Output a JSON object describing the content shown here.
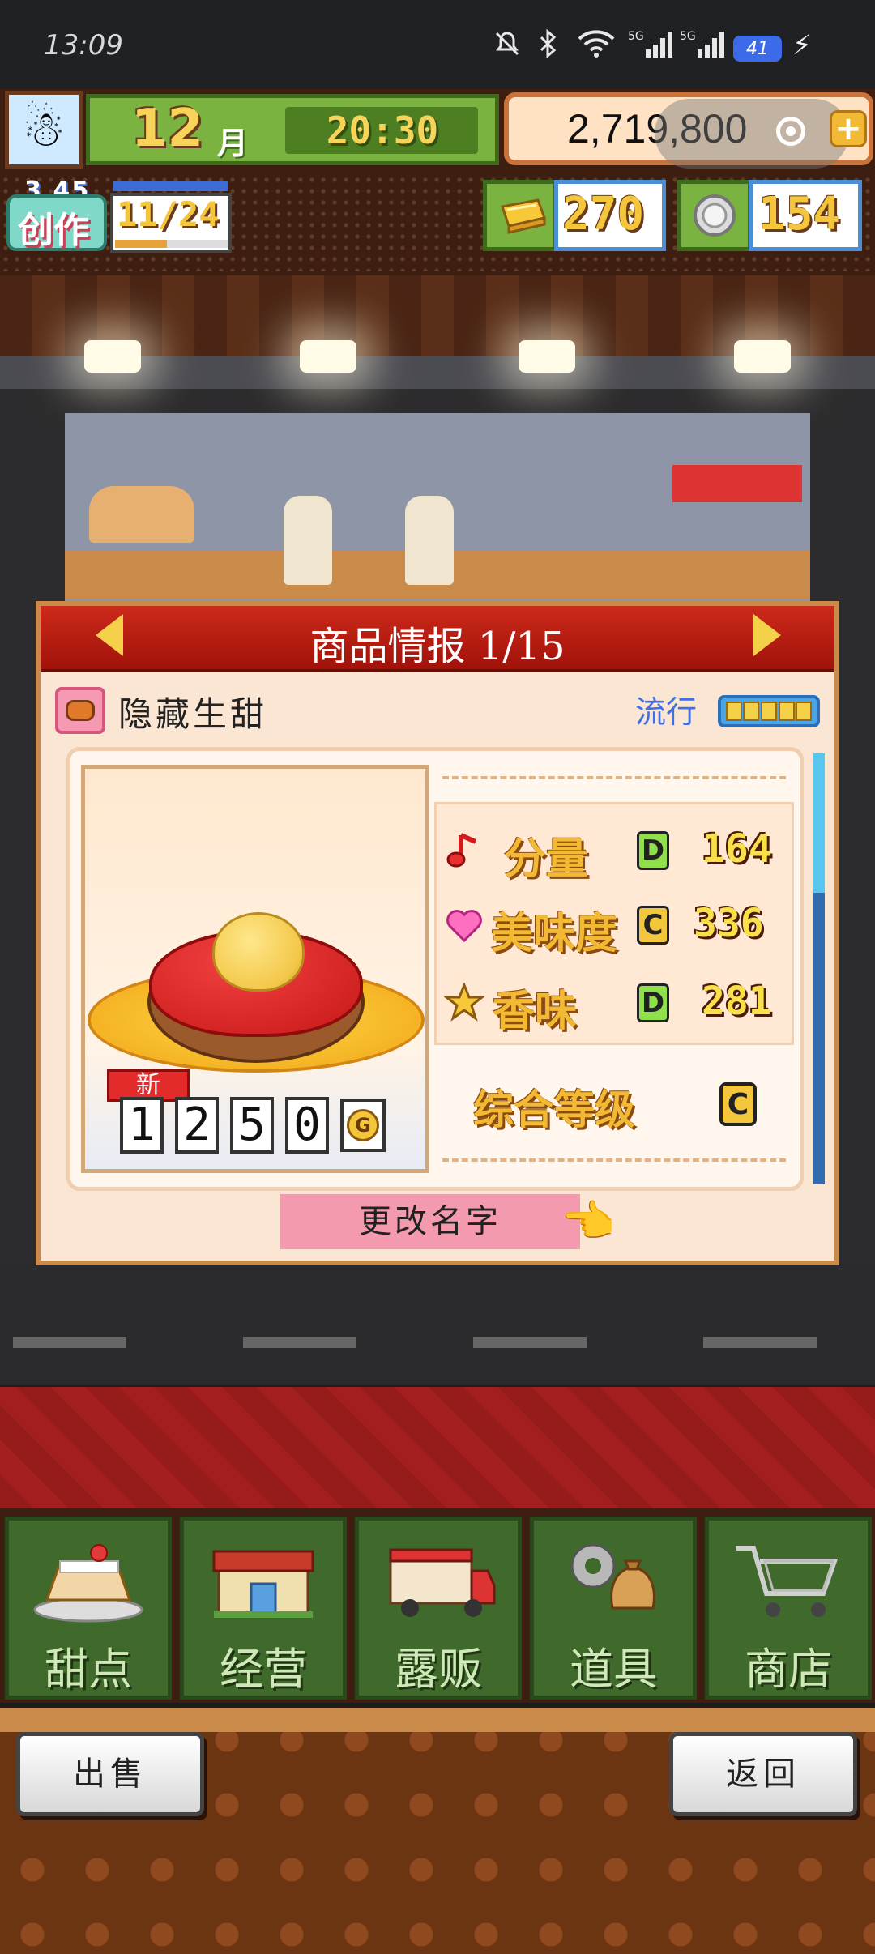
{
  "status_bar": {
    "time": "13:09",
    "battery": "41"
  },
  "hud": {
    "month_number": "12",
    "month_unit": "月",
    "clock": "20:30",
    "money": "2,719,800",
    "create_small": "3 45",
    "create_label": "创作",
    "create_count": "11/24",
    "create_progress": 0.46,
    "gold_bars": "270",
    "medals": "154"
  },
  "dialog": {
    "title": "商品情报 1/15",
    "product_name": "隐藏生甜",
    "trend_label": "流行",
    "trend_level": 5,
    "new_badge": "新",
    "price_digits": [
      "1",
      "2",
      "5",
      "0"
    ],
    "price_unit": "G",
    "stats": [
      {
        "label": "分量",
        "grade": "D",
        "value": "164",
        "icon": "music-note-icon"
      },
      {
        "label": "美味度",
        "grade": "C",
        "value": "336",
        "icon": "heart-icon"
      },
      {
        "label": "香味",
        "grade": "D",
        "value": "281",
        "icon": "star-icon"
      }
    ],
    "overall_label": "综合等级",
    "overall_grade": "C",
    "rename_label": "更改名字"
  },
  "menu": [
    {
      "label": "甜点",
      "icon": "cake-icon"
    },
    {
      "label": "经营",
      "icon": "shop-icon"
    },
    {
      "label": "露贩",
      "icon": "food-truck-icon"
    },
    {
      "label": "道具",
      "icon": "tools-bag-icon"
    },
    {
      "label": "商店",
      "icon": "shopping-cart-icon"
    }
  ],
  "bottom": {
    "sell_label": "出售",
    "back_label": "返回"
  },
  "colors": {
    "header_red": "#cc2a1a",
    "menu_green": "#3f6a2c",
    "gold_text": "#f3c63b",
    "trend_blue": "#3f6fe0"
  }
}
